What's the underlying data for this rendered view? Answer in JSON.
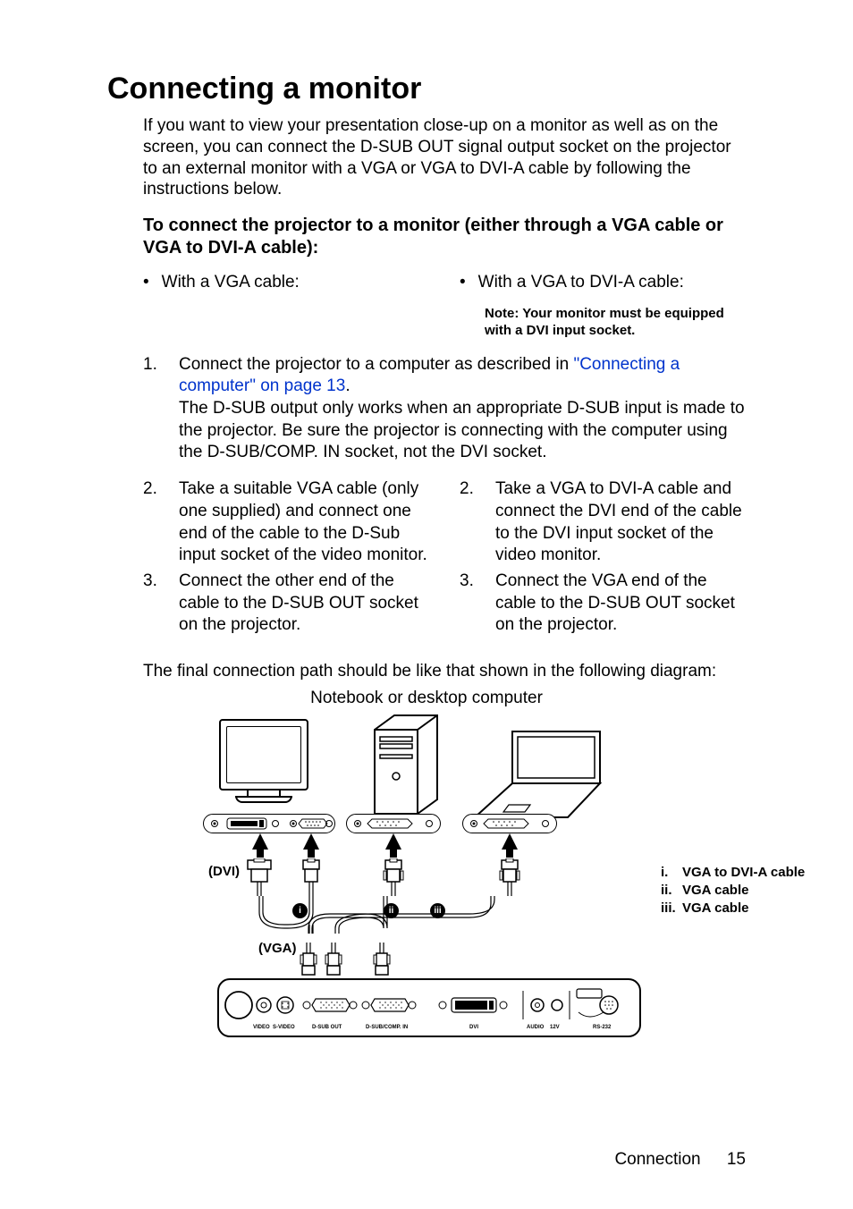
{
  "title": "Connecting a monitor",
  "intro": "If you want to view your presentation close-up on a monitor as well as on the screen, you can connect the D-SUB OUT signal output socket on the projector to an external monitor with a VGA or VGA to DVI-A cable by following the instructions below.",
  "sub": "To connect the projector to a monitor (either through a VGA cable or VGA to DVI-A cable):",
  "leftBullet": "With a VGA cable:",
  "rightBullet": "With a VGA to DVI-A cable:",
  "note": "Note: Your monitor must be equipped with a DVI input socket.",
  "step1_a": "Connect the projector to a computer as described in ",
  "step1_link": "\"Connecting a computer\" on page 13",
  "step1_b": ".",
  "step1_c": "The D-SUB output only works when an appropriate D-SUB input is made to the projector. Be sure the projector is connecting with the computer using the D-SUB/COMP. IN socket, not the DVI socket.",
  "left2": "Take a suitable VGA cable (only one supplied) and connect one end of the cable to the D-Sub input socket of the video monitor.",
  "left3": "Connect the other end of the cable to the D-SUB OUT socket on the projector.",
  "right2": "Take a VGA to DVI-A cable and connect the DVI end of the cable to the DVI input socket of the video monitor.",
  "right3": "Connect the VGA end of the cable to the D-SUB OUT socket on the projector.",
  "final": "The final connection path should be like that shown in the following diagram:",
  "caption": "Notebook or desktop computer",
  "dviLabel": "(DVI)",
  "vgaLabel": "(VGA)",
  "legend_i_lbl": "i.",
  "legend_i": "VGA to DVI-A cable",
  "legend_ii_lbl": "ii.",
  "legend_ii": "VGA cable",
  "legend_iii_lbl": "iii.",
  "legend_iii": "VGA cable",
  "ports": {
    "video": "VIDEO",
    "svideo": "S-VIDEO",
    "dsubout": "D-SUB OUT",
    "dsubin": "D-SUB/COMP. IN",
    "dvi": "DVI",
    "audio": "AUDIO",
    "v12": "12V",
    "rs232": "RS-232"
  },
  "footerText": "Connection",
  "footerPage": "15"
}
